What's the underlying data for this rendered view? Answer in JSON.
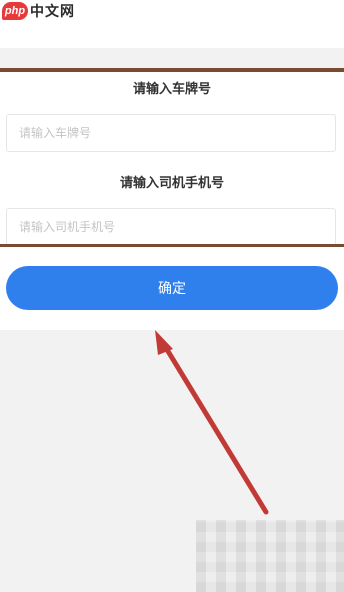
{
  "watermark": {
    "logo": "php",
    "site": "中文网"
  },
  "form": {
    "plate_label": "请输入车牌号",
    "plate_placeholder": "请输入车牌号",
    "phone_label": "请输入司机手机号",
    "phone_placeholder": "请输入司机手机号",
    "confirm_label": "确定"
  },
  "colors": {
    "accent": "#2f80ed",
    "arrow": "#c23a36",
    "frame": "#7a4a32"
  }
}
